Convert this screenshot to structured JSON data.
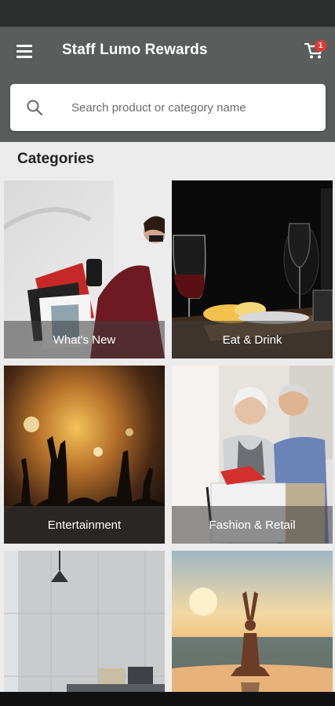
{
  "header": {
    "title": "Staff Lumo Rewards",
    "cart_count": "1",
    "menu_icon": "hamburger-menu-icon",
    "cart_icon": "shopping-cart-icon"
  },
  "search": {
    "placeholder": "Search product or category name",
    "value": ""
  },
  "categories": {
    "heading": "Categories",
    "items": [
      {
        "label": "What's New"
      },
      {
        "label": "Eat & Drink"
      },
      {
        "label": "Entertainment"
      },
      {
        "label": "Fashion & Retail"
      },
      {
        "label": ""
      },
      {
        "label": ""
      }
    ]
  },
  "colors": {
    "header_bg": "#5b5d5d",
    "status_bar": "#2c2e2e",
    "badge": "#e53935",
    "page_bg": "#ececec"
  }
}
